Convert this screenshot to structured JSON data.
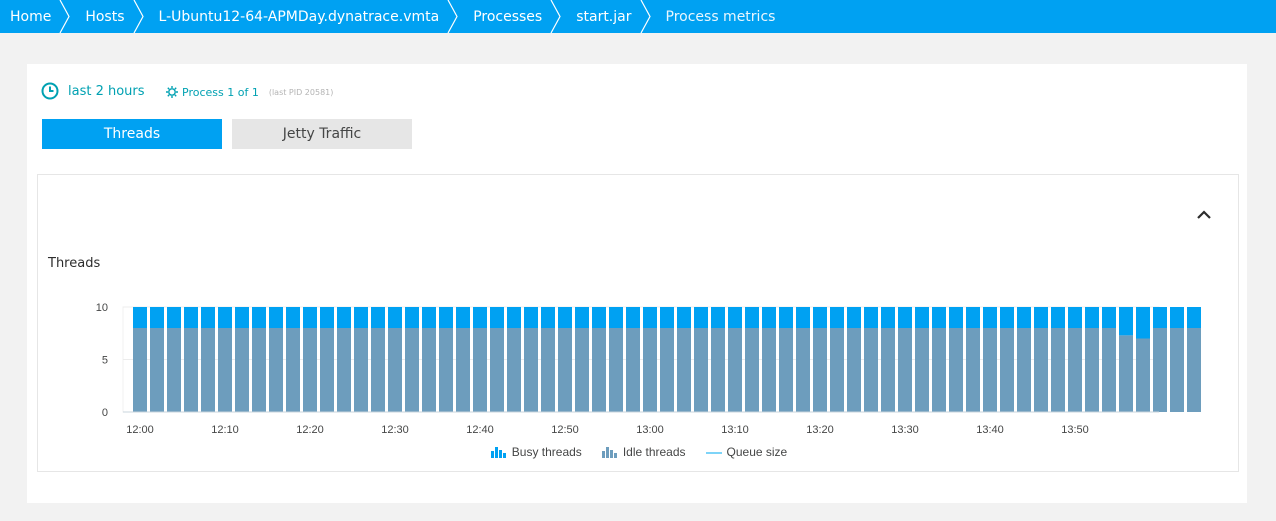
{
  "breadcrumb": [
    {
      "label": "Home"
    },
    {
      "label": "Hosts"
    },
    {
      "label": "L-Ubuntu12-64-APMDay.dynatrace.vmta"
    },
    {
      "label": "Processes"
    },
    {
      "label": "start.jar"
    },
    {
      "label": "Process metrics"
    }
  ],
  "filters": {
    "timeframe": "last 2 hours",
    "process": "Process 1 of 1",
    "pid": "(last PID 20581)"
  },
  "tabs": [
    {
      "label": "Threads",
      "active": true
    },
    {
      "label": "Jetty Traffic",
      "active": false
    }
  ],
  "colors": {
    "brand": "#00a1f2",
    "busy": "#00a1f2",
    "idle": "#6d9dbd",
    "queue": "#52c5f5",
    "link": "#00a1b2"
  },
  "chart": {
    "title": "Threads",
    "collapse_icon": "chevron-up-icon",
    "legend": [
      {
        "label": "Busy threads",
        "icon": "bar-chart-icon",
        "color": "#00a1f2"
      },
      {
        "label": "Idle threads",
        "icon": "bar-chart-icon",
        "color": "#6d9dbd"
      },
      {
        "label": "Queue size",
        "icon": "line-icon",
        "color": "#52c5f5"
      }
    ]
  },
  "chart_data": {
    "type": "bar",
    "stacked": true,
    "title": "Threads",
    "x_ticks": [
      "12:00",
      "12:10",
      "12:20",
      "12:30",
      "12:40",
      "12:50",
      "13:00",
      "13:10",
      "13:20",
      "13:30",
      "13:40",
      "13:50"
    ],
    "y_ticks": [
      0,
      5,
      10
    ],
    "ylim": [
      0,
      10
    ],
    "grid": true,
    "legend_position": "bottom",
    "series": [
      {
        "name": "Busy threads",
        "color": "#00a1f2",
        "values": [
          2,
          2,
          2,
          2,
          2,
          2,
          2,
          2,
          2,
          2,
          2,
          2,
          2,
          2,
          2,
          2,
          2,
          2,
          2,
          2,
          2,
          2,
          2,
          2,
          2,
          2,
          2,
          2,
          2,
          2,
          2,
          2,
          2,
          2,
          2,
          2,
          2,
          2,
          2,
          2,
          2,
          2,
          2,
          2,
          2,
          2,
          2,
          2,
          2,
          2,
          2,
          2,
          2,
          2,
          2,
          2,
          2,
          2,
          2.7,
          3,
          2,
          2,
          2
        ]
      },
      {
        "name": "Idle threads",
        "color": "#6d9dbd",
        "values": [
          8,
          8,
          8,
          8,
          8,
          8,
          8,
          8,
          8,
          8,
          8,
          8,
          8,
          8,
          8,
          8,
          8,
          8,
          8,
          8,
          8,
          8,
          8,
          8,
          8,
          8,
          8,
          8,
          8,
          8,
          8,
          8,
          8,
          8,
          8,
          8,
          8,
          8,
          8,
          8,
          8,
          8,
          8,
          8,
          8,
          8,
          8,
          8,
          8,
          8,
          8,
          8,
          8,
          8,
          8,
          8,
          8,
          8,
          7.3,
          7,
          8,
          8,
          8
        ]
      },
      {
        "name": "Queue size",
        "color": "#52c5f5",
        "values": [
          0,
          0,
          0,
          0,
          0,
          0,
          0,
          0,
          0,
          0,
          0,
          0,
          0,
          0,
          0,
          0,
          0,
          0,
          0,
          0,
          0,
          0,
          0,
          0,
          0,
          0,
          0,
          0,
          0,
          0,
          0,
          0,
          0,
          0,
          0,
          0,
          0,
          0,
          0,
          0,
          0,
          0,
          0,
          0,
          0,
          0,
          0,
          0,
          0,
          0,
          0,
          0,
          0,
          0,
          0,
          0,
          0,
          0,
          0,
          0,
          0,
          0,
          0
        ]
      }
    ]
  }
}
